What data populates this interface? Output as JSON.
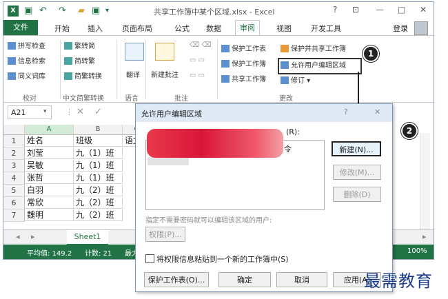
{
  "window": {
    "title": "共享工作簿中某个区域.xlsx - Excel",
    "excel_logo": "X",
    "controls": [
      "?",
      "⊡",
      "—",
      "□",
      "✕"
    ]
  },
  "tabs": {
    "file": "文件",
    "items": [
      "开始",
      "插入",
      "页面布局",
      "公式",
      "数据",
      "审阅",
      "视图",
      "开发工具"
    ],
    "active": "审阅",
    "login": "登录"
  },
  "ribbon": {
    "proofing": {
      "items": [
        "拼写检查",
        "信息检索",
        "同义词库"
      ],
      "group": "校对"
    },
    "chinese": {
      "items": [
        "繁转简",
        "简转繁",
        "简繁转换"
      ],
      "group": "中文简繁转换"
    },
    "language": {
      "translate": "翻译",
      "group": "语言"
    },
    "comments": {
      "new_comment": "新建批注",
      "group": "批注"
    },
    "changes": {
      "items": [
        "保护工作表",
        "保护工作簿",
        "共享工作簿",
        "保护并共享工作簿",
        "允许用户编辑区域",
        "修订"
      ],
      "group": "更改"
    }
  },
  "callouts": [
    "1",
    "2"
  ],
  "formula_bar": {
    "name_box": "A21",
    "cancel": "✕",
    "enter": "✓"
  },
  "grid": {
    "columns": [
      "A",
      "B",
      "C"
    ],
    "rows": [
      "1",
      "2",
      "3",
      "4",
      "5",
      "6",
      "7"
    ],
    "cells": [
      [
        "姓名",
        "班级",
        "语文"
      ],
      [
        "刘莹",
        "九（1）班",
        ""
      ],
      [
        "吴敏",
        "九（1）班",
        ""
      ],
      [
        "张哲",
        "九（1）班",
        ""
      ],
      [
        "白羽",
        "九（2）班",
        ""
      ],
      [
        "常欣",
        "九（2）班",
        ""
      ],
      [
        "魏明",
        "九（2）班",
        ""
      ]
    ]
  },
  "sheet": {
    "tab": "Sheet1"
  },
  "statusbar": {
    "average": "平均值: 149.2",
    "count": "计数: 21",
    "sum_prefix": "最大",
    "zoom": "100%"
  },
  "dialog": {
    "title": "允许用户编辑区域",
    "help": "?",
    "close": "✕",
    "ranges_label_end": "(R):",
    "list_fragment": "令",
    "buttons": {
      "new": "新建(N)...",
      "modify": "修改(M)...",
      "delete": "删除(D)"
    },
    "no_password_label": "指定不需要密码就可以编辑该区域的用户:",
    "permissions": "权限(P)...",
    "paste_checkbox": "将权限信息粘贴到一个新的工作簿中(S)",
    "protect_sheet": "保护工作表(O)...",
    "ok": "确定",
    "cancel": "取消",
    "apply": "应用(A)"
  },
  "watermark": "最需教育",
  "colors": {
    "excel_green": "#217346",
    "dialog_title": "#dfe9f5",
    "redact": "#e0243c"
  }
}
